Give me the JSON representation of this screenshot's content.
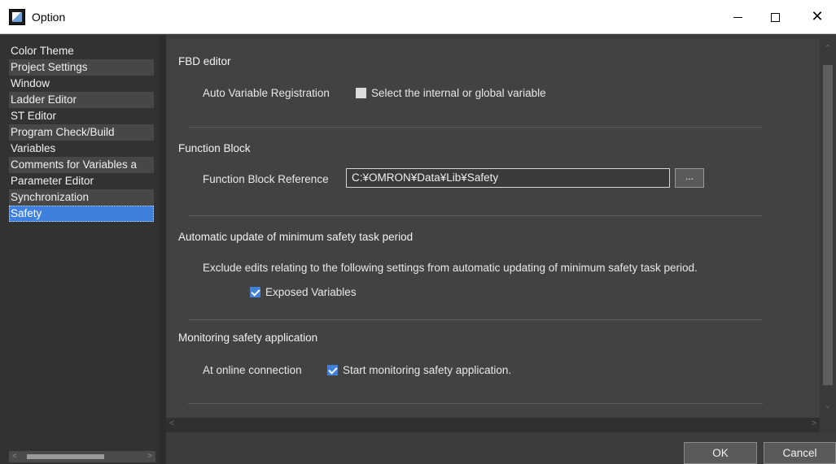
{
  "window": {
    "title": "Option",
    "icon": "app-icon",
    "controls": {
      "minimize": "minimize-icon",
      "maximize": "maximize-icon",
      "close": "close-icon"
    }
  },
  "nav": {
    "items": [
      {
        "label": "Color Theme"
      },
      {
        "label": "Project Settings"
      },
      {
        "label": "Window"
      },
      {
        "label": "Ladder Editor"
      },
      {
        "label": "ST Editor"
      },
      {
        "label": "Program Check/Build"
      },
      {
        "label": "Variables"
      },
      {
        "label": "Comments for Variables a"
      },
      {
        "label": "Parameter Editor"
      },
      {
        "label": "Synchronization"
      },
      {
        "label": "Safety"
      }
    ],
    "selected_index": 10
  },
  "fbd": {
    "title": "FBD editor",
    "auto_var_label": "Auto Variable Registration",
    "auto_var_checkbox_label": "Select the internal or global variable",
    "auto_var_checked": false
  },
  "function_block": {
    "title": "Function Block",
    "reference_label": "Function Block Reference",
    "reference_value": "C:¥OMRON¥Data¥Lib¥Safety",
    "browse_label": "..."
  },
  "auto_update": {
    "title": "Automatic update of minimum safety task period",
    "description": "Exclude edits relating to the following settings from automatic updating of minimum safety task period.",
    "exposed_label": "Exposed Variables",
    "exposed_checked": true
  },
  "monitoring": {
    "title": "Monitoring safety application",
    "online_label": "At online connection",
    "start_label": "Start monitoring safety application.",
    "start_checked": true
  },
  "buttons": {
    "ok": "OK",
    "cancel": "Cancel"
  },
  "colors": {
    "accent": "#3f7fdd",
    "panel": "#424242",
    "nav_bg": "#323232"
  }
}
